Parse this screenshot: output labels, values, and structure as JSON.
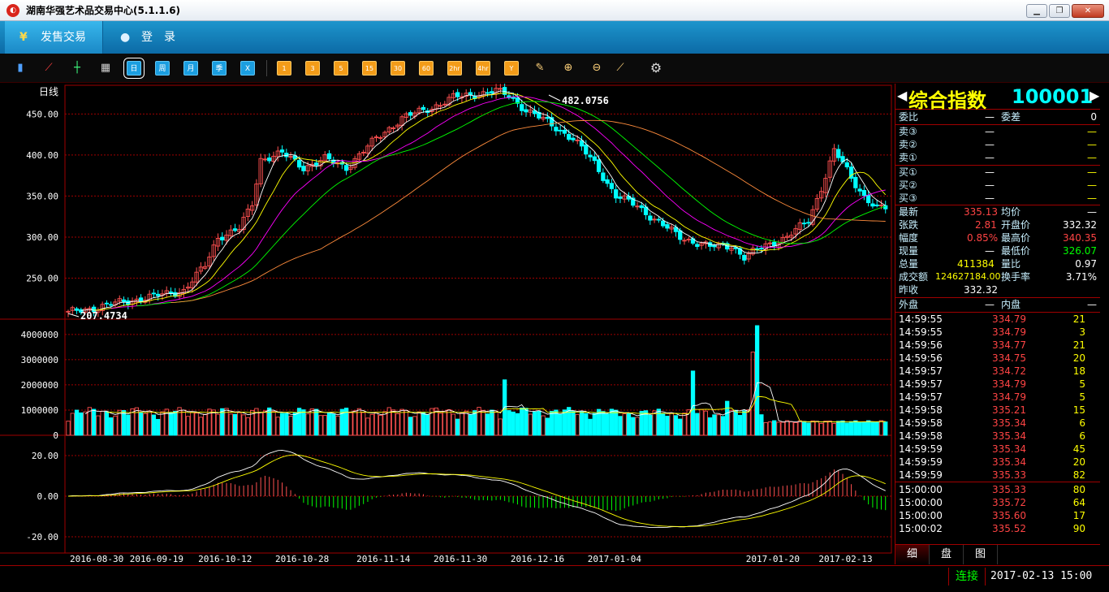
{
  "window": {
    "title": "湖南华强艺术品交易中心(5.1.1.6)",
    "min_icon": "minimize-icon",
    "max_icon": "maximize-icon",
    "close_icon": "close-icon"
  },
  "menu": {
    "sell_label": "发售交易",
    "login_label": "登　录"
  },
  "toolbar": {
    "chart_icons": [
      "bar-chart-icon",
      "line-chart-icon",
      "candlestick-icon",
      "calendar-icon"
    ],
    "periods": [
      "日",
      "周",
      "月",
      "季",
      "X"
    ],
    "active_period": "日",
    "minutes": [
      "1",
      "3",
      "5",
      "15",
      "30",
      "60",
      "2hr",
      "4hr",
      "Y"
    ],
    "tools": [
      "edit-icon",
      "zoom-in-icon",
      "zoom-out-icon",
      "draw-icon",
      "gear-icon"
    ]
  },
  "chart": {
    "period_label": "日线",
    "price_ticks": [
      "450.00",
      "400.00",
      "350.00",
      "300.00",
      "250.00"
    ],
    "volume_ticks": [
      "4000000",
      "3000000",
      "2000000",
      "1000000",
      "0"
    ],
    "macd_ticks": [
      "20.00",
      "0.00",
      "-20.00"
    ],
    "max_label": "482.0756",
    "min_label": "207.4734",
    "dates": [
      "2016-08-30",
      "2016-09-19",
      "2016-10-12",
      "2016-10-28",
      "2016-11-14",
      "2016-11-30",
      "2016-12-16",
      "2017-01-04",
      "2017-01-20",
      "2017-02-13"
    ],
    "colors": {
      "up": "#ff5050",
      "down": "#00ffff",
      "ma5": "#ffffff",
      "ma10": "#ffff00",
      "ma20": "#ff00ff",
      "ma30": "#00ff00",
      "ma60": "#ff8c3c",
      "grid": "#a00000"
    }
  },
  "chart_data": {
    "type": "candlestick",
    "xlabel": "",
    "ylabel": "",
    "ylim": [
      200,
      485
    ],
    "close_keypoints": [
      [
        0,
        207.5
      ],
      [
        10,
        218
      ],
      [
        20,
        228
      ],
      [
        27,
        235
      ],
      [
        32,
        265
      ],
      [
        35,
        300
      ],
      [
        40,
        310
      ],
      [
        43,
        340
      ],
      [
        45,
        395
      ],
      [
        50,
        402
      ],
      [
        55,
        385
      ],
      [
        60,
        395
      ],
      [
        65,
        385
      ],
      [
        72,
        420
      ],
      [
        78,
        445
      ],
      [
        85,
        458
      ],
      [
        90,
        470
      ],
      [
        95,
        474
      ],
      [
        100,
        478
      ],
      [
        103,
        472
      ],
      [
        107,
        455
      ],
      [
        112,
        440
      ],
      [
        118,
        420
      ],
      [
        123,
        390
      ],
      [
        128,
        350
      ],
      [
        133,
        338
      ],
      [
        138,
        318
      ],
      [
        143,
        300
      ],
      [
        150,
        288
      ],
      [
        155,
        290
      ],
      [
        158,
        275
      ],
      [
        163,
        290
      ],
      [
        168,
        300
      ],
      [
        173,
        320
      ],
      [
        176,
        360
      ],
      [
        179,
        405
      ],
      [
        181,
        390
      ],
      [
        183,
        372
      ],
      [
        186,
        350
      ],
      [
        189,
        335
      ],
      [
        191,
        335
      ]
    ],
    "volume_ticks": [
      4000000,
      3000000,
      2000000,
      1000000,
      0
    ],
    "volume_peak": 4350000,
    "macd_ylim": [
      -28,
      30
    ]
  },
  "quote": {
    "name": "综合指数",
    "code": "100001",
    "weibi_label": "委比",
    "weibi_value": "—",
    "weicha_label": "委差",
    "weicha_value": "0",
    "sell": [
      {
        "label": "卖③",
        "price": "—",
        "vol": "—"
      },
      {
        "label": "卖②",
        "price": "—",
        "vol": "—"
      },
      {
        "label": "卖①",
        "price": "—",
        "vol": "—"
      }
    ],
    "buy": [
      {
        "label": "买①",
        "price": "—",
        "vol": "—"
      },
      {
        "label": "买②",
        "price": "—",
        "vol": "—"
      },
      {
        "label": "买③",
        "price": "—",
        "vol": "—"
      }
    ],
    "latest_label": "最新",
    "latest": "335.13",
    "avg_label": "均价",
    "avg": "—",
    "change_label": "张跌",
    "change": "2.81",
    "open_label": "开盘价",
    "open": "332.32",
    "pct_label": "幅度",
    "pct": "0.85%",
    "high_label": "最高价",
    "high": "340.35",
    "cur_label": "现量",
    "cur": "—",
    "low_label": "最低价",
    "low": "326.07",
    "total_label": "总量",
    "total": "411384",
    "ratio_label": "量比",
    "ratio": "0.97",
    "amount_label": "成交额",
    "amount": "124627184.00",
    "turnover_label": "换手率",
    "turnover": "3.71%",
    "prev_label": "昨收",
    "prev": "332.32",
    "outer_label": "外盘",
    "outer": "—",
    "inner_label": "内盘",
    "inner": "—"
  },
  "ticks": [
    {
      "time": "14:59:55",
      "price": "334.79",
      "vol": "21"
    },
    {
      "time": "14:59:55",
      "price": "334.79",
      "vol": "3"
    },
    {
      "time": "14:59:56",
      "price": "334.77",
      "vol": "21"
    },
    {
      "time": "14:59:56",
      "price": "334.75",
      "vol": "20"
    },
    {
      "time": "14:59:57",
      "price": "334.72",
      "vol": "18"
    },
    {
      "time": "14:59:57",
      "price": "334.79",
      "vol": "5"
    },
    {
      "time": "14:59:57",
      "price": "334.79",
      "vol": "5"
    },
    {
      "time": "14:59:58",
      "price": "335.21",
      "vol": "15"
    },
    {
      "time": "14:59:58",
      "price": "335.34",
      "vol": "6"
    },
    {
      "time": "14:59:58",
      "price": "335.34",
      "vol": "6"
    },
    {
      "time": "14:59:59",
      "price": "335.34",
      "vol": "45"
    },
    {
      "time": "14:59:59",
      "price": "335.34",
      "vol": "20"
    },
    {
      "time": "14:59:59",
      "price": "335.33",
      "vol": "82"
    },
    {
      "time": "15:00:00",
      "price": "335.33",
      "vol": "80"
    },
    {
      "time": "15:00:00",
      "price": "335.72",
      "vol": "64"
    },
    {
      "time": "15:00:00",
      "price": "335.60",
      "vol": "17"
    },
    {
      "time": "15:00:02",
      "price": "335.52",
      "vol": "90"
    }
  ],
  "tabs": [
    "细",
    "盘",
    "图"
  ],
  "status": {
    "connection": "连接",
    "datetime": "2017-02-13 15:00"
  }
}
